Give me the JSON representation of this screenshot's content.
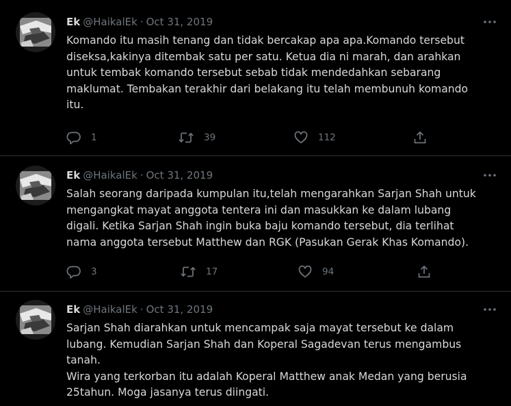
{
  "tweets": [
    {
      "name": "Ek",
      "handle": "@HaikalEk",
      "separator": "·",
      "date": "Oct 31, 2019",
      "lines": [
        "Komando itu masih tenang dan tidak bercakap apa apa.Komando tersebut",
        "diseksa,kakinya ditembak satu per satu. Ketua dia ni marah, dan arahkan",
        "untuk tembak komando tersebut sebab tidak mendedahkan sebarang",
        "maklumat. Tembakan terakhir dari belakang itu telah membunuh komando",
        "itu."
      ],
      "replies": "1",
      "retweets": "39",
      "likes": "112"
    },
    {
      "name": "Ek",
      "handle": "@HaikalEk",
      "separator": "·",
      "date": "Oct 31, 2019",
      "lines": [
        "Salah seorang daripada kumpulan itu,telah mengarahkan Sarjan Shah untuk",
        "mengangkat mayat anggota tentera ini dan masukkan ke dalam lubang",
        "digali. Ketika Sarjan Shah ingin buka baju komando tersebut, dia terlihat",
        "nama anggota tersebut Matthew dan RGK (Pasukan Gerak Khas Komando)."
      ],
      "replies": "3",
      "retweets": "17",
      "likes": "94"
    },
    {
      "name": "Ek",
      "handle": "@HaikalEk",
      "separator": "·",
      "date": "Oct 31, 2019",
      "lines": [
        "Sarjan Shah diarahkan untuk mencampak saja mayat tersebut ke dalam",
        "lubang. Kemudian Sarjan Shah dan Koperal Sagadevan terus mengambus",
        "tanah.",
        "Wira yang terkorban itu adalah Koperal Matthew anak Medan yang berusia",
        "25tahun. Moga jasanya terus diingati."
      ]
    }
  ],
  "icons": {
    "more": "more-horizontal-icon",
    "reply": "reply-bubble-icon",
    "retweet": "retweet-arrows-icon",
    "like": "heart-icon",
    "share": "share-upload-icon"
  },
  "colors": {
    "background": "#000000",
    "text": "#d9d9d9",
    "muted": "#6e767d",
    "divider": "#2f3336"
  }
}
